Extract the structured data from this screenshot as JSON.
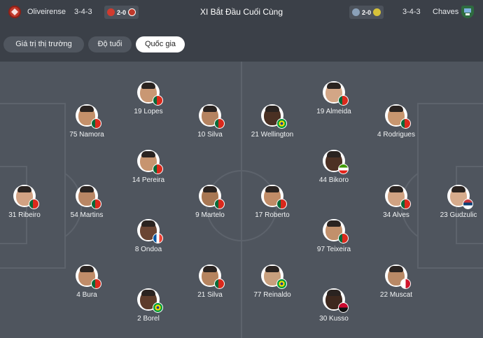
{
  "header": {
    "home_team": "Oliveirense",
    "home_formation": "3-4-3",
    "home_score": "2-0",
    "title": "XI Bắt Đầu Cuối Cùng",
    "away_score": "2-0",
    "away_formation": "3-4-3",
    "away_team": "Chaves"
  },
  "tabs": [
    {
      "label": "Giá trị thị trường",
      "active": false
    },
    {
      "label": "Độ tuổi",
      "active": false
    },
    {
      "label": "Quốc gia",
      "active": true
    }
  ],
  "players": [
    {
      "label": "19 Lopes",
      "flag": "portugal",
      "skin": "#c99773"
    },
    {
      "label": "75 Namora",
      "flag": "portugal",
      "skin": "#c4906a"
    },
    {
      "label": "10 Silva",
      "flag": "portugal",
      "skin": "#b58360"
    },
    {
      "label": "14 Pereira",
      "flag": "portugal",
      "skin": "#c7946f"
    },
    {
      "label": "31 Ribeiro",
      "flag": "portugal",
      "skin": "#d2a283"
    },
    {
      "label": "54 Martins",
      "flag": "portugal",
      "skin": "#b98664"
    },
    {
      "label": "9 Martelo",
      "flag": "portugal",
      "skin": "#a87753"
    },
    {
      "label": "8 Ondoa",
      "flag": "france",
      "skin": "#6a4533"
    },
    {
      "label": "4 Bura",
      "flag": "portugal",
      "skin": "#c08c69"
    },
    {
      "label": "21 Silva",
      "flag": "portugal",
      "skin": "#b6845f"
    },
    {
      "label": "2 Borel",
      "flag": "brazil",
      "skin": "#5e3c2b"
    },
    {
      "label": "19 Almeida",
      "flag": "portugal",
      "skin": "#d3a686"
    },
    {
      "label": "21 Wellington",
      "flag": "brazil",
      "skin": "#4a3023"
    },
    {
      "label": "4 Rodrigues",
      "flag": "portugal",
      "skin": "#c8966f"
    },
    {
      "label": "44 Bikoro",
      "flag": "equatorial-guinea",
      "skin": "#4d3124"
    },
    {
      "label": "17 Roberto",
      "flag": "portugal",
      "skin": "#c18c67"
    },
    {
      "label": "34 Alves",
      "flag": "portugal",
      "skin": "#d0a282"
    },
    {
      "label": "23 Gudzulic",
      "flag": "serbia",
      "skin": "#d6ab8c"
    },
    {
      "label": "97 Teixeira",
      "flag": "portugal",
      "skin": "#c2906b"
    },
    {
      "label": "77 Reinaldo",
      "flag": "brazil",
      "skin": "#c9a07e"
    },
    {
      "label": "22 Muscat",
      "flag": "malta",
      "skin": "#b98966"
    },
    {
      "label": "30 Kusso",
      "flag": "angola",
      "skin": "#3e281d"
    }
  ],
  "colors": {
    "pitch": "#4f555e",
    "header_bg": "#3b4048",
    "tab_bg": "#50565f",
    "tab_active_bg": "#ffffff",
    "home_logo": "#c0392b",
    "away_logo": "#2e6b3f"
  }
}
